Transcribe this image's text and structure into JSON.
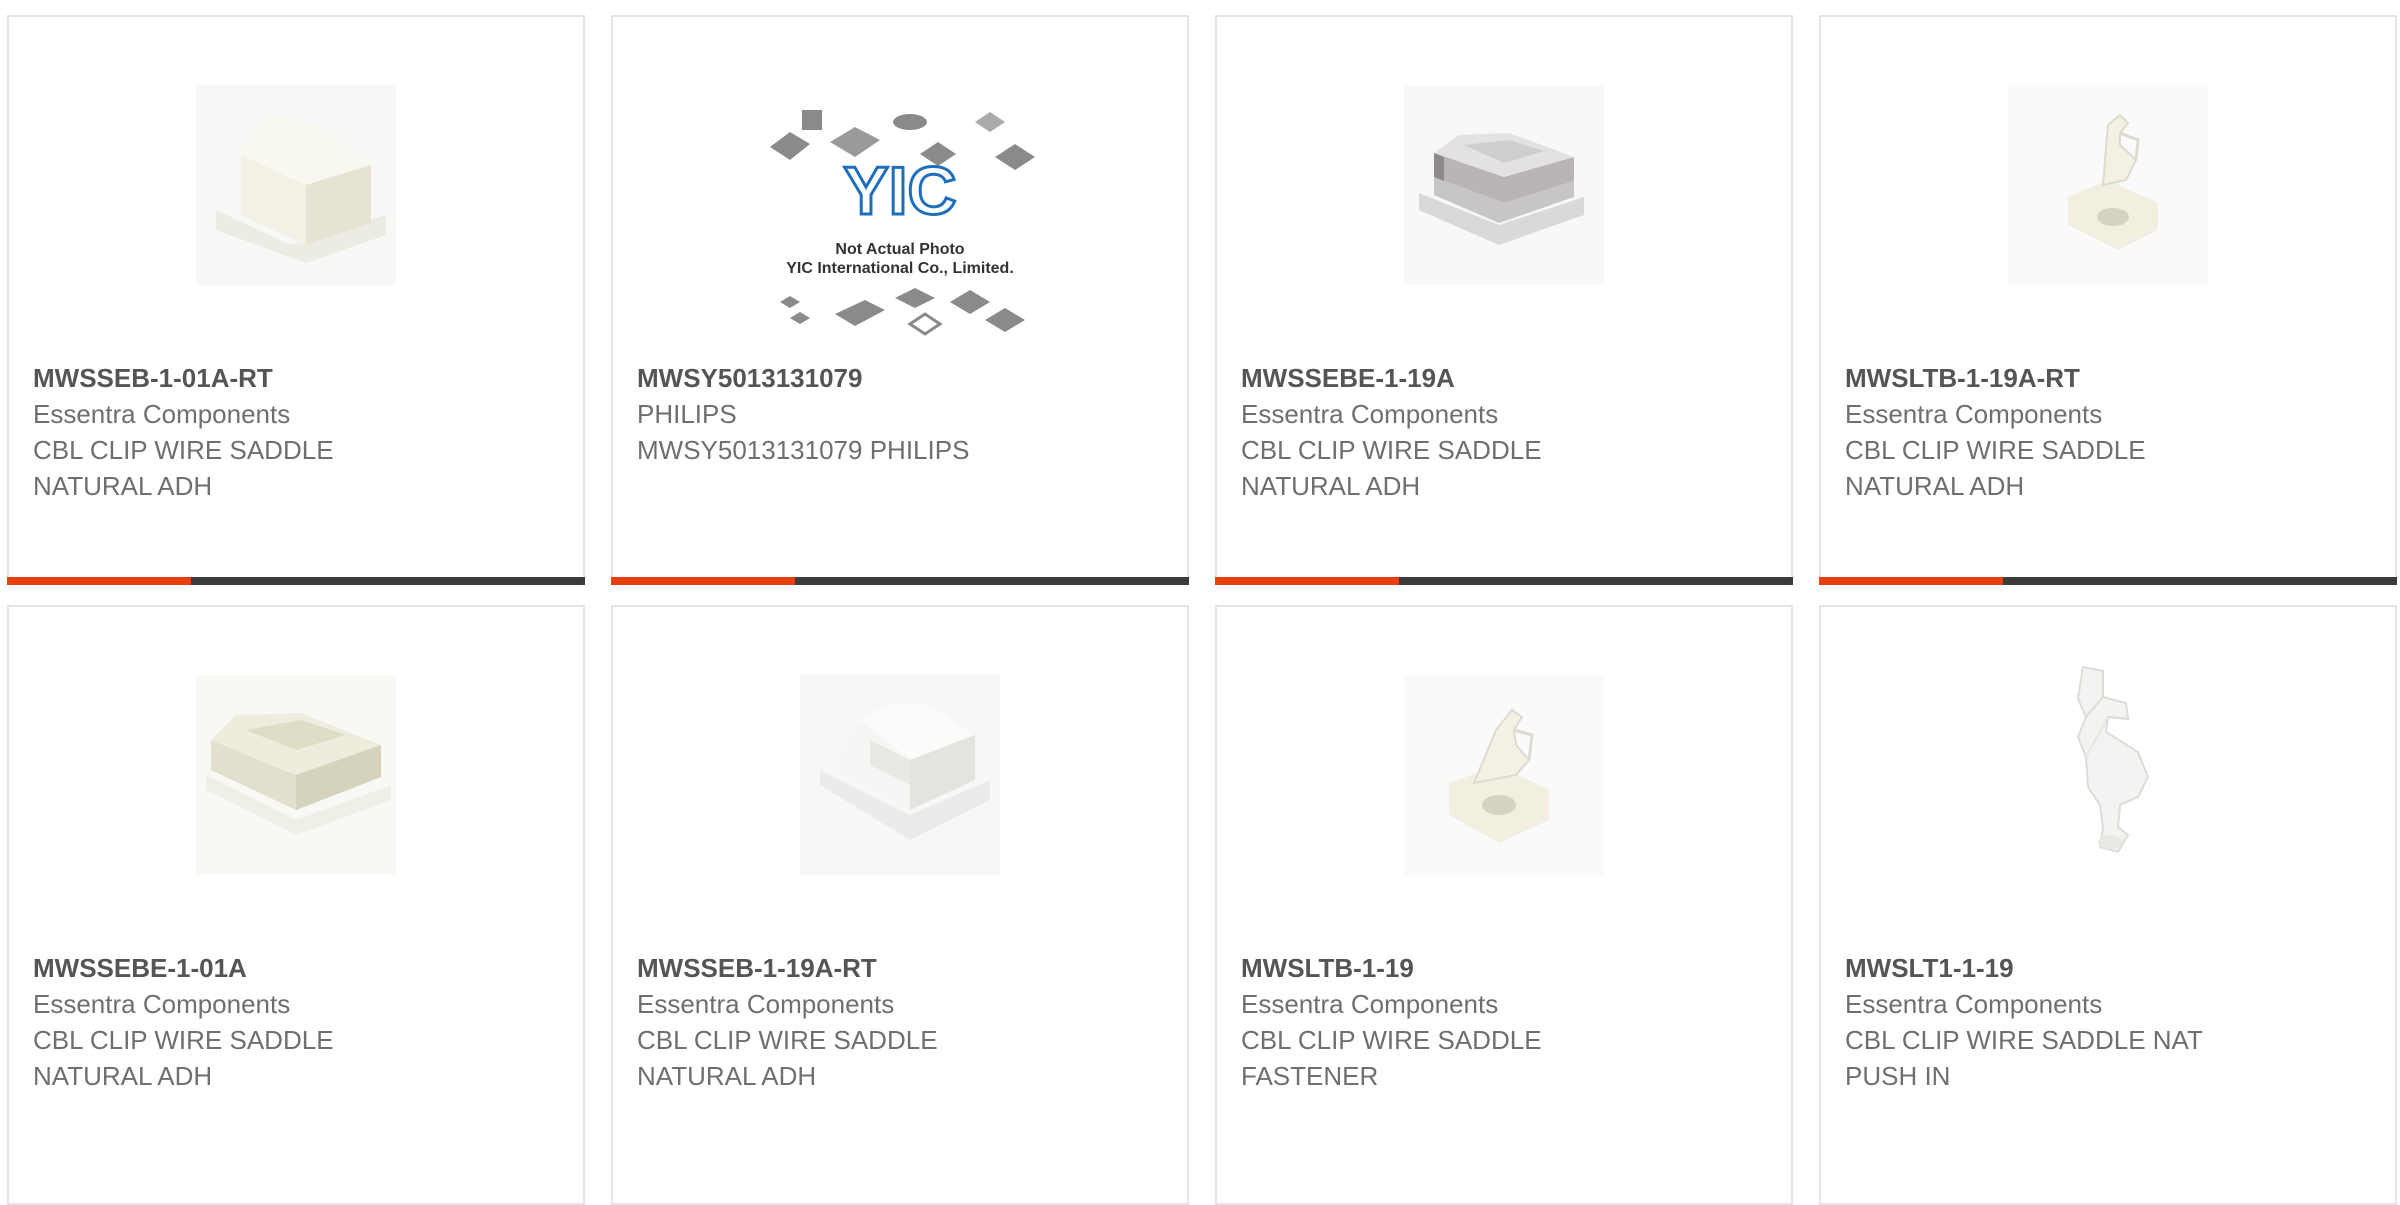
{
  "products": [
    {
      "part_number": "MWSSEB-1-01A-RT",
      "manufacturer": "Essentra Components",
      "description": "CBL CLIP WIRE SADDLE NATURAL ADH",
      "image_icon": "adhesive-saddle-clip-icon"
    },
    {
      "part_number": "MWSY5013131079",
      "manufacturer": "PHILIPS",
      "description": "MWSY5013131079 PHILIPS",
      "image_icon": "placeholder-chip-icon",
      "placeholder": {
        "logo_text": "YIC",
        "line1": "Not Actual Photo",
        "line2": "YIC International Co., Limited."
      }
    },
    {
      "part_number": "MWSSEBE-1-19A",
      "manufacturer": "Essentra Components",
      "description": "CBL CLIP WIRE SADDLE NATURAL ADH",
      "image_icon": "gray-saddle-clip-icon"
    },
    {
      "part_number": "MWSLTB-1-19A-RT",
      "manufacturer": "Essentra Components",
      "description": "CBL CLIP WIRE SADDLE NATURAL ADH",
      "image_icon": "latch-clip-icon"
    },
    {
      "part_number": "MWSSEBE-1-01A",
      "manufacturer": "Essentra Components",
      "description": "CBL CLIP WIRE SADDLE NATURAL ADH",
      "image_icon": "adhesive-saddle-clip-icon"
    },
    {
      "part_number": "MWSSEB-1-19A-RT",
      "manufacturer": "Essentra Components",
      "description": "CBL CLIP WIRE SADDLE NATURAL ADH",
      "image_icon": "adhesive-saddle-clip-icon"
    },
    {
      "part_number": "MWSLTB-1-19",
      "manufacturer": "Essentra Components",
      "description": "CBL CLIP WIRE SADDLE FASTENER",
      "image_icon": "latch-clip-icon"
    },
    {
      "part_number": "MWSLT1-1-19",
      "manufacturer": "Essentra Components",
      "description": "CBL CLIP WIRE SADDLE NAT PUSH IN",
      "image_icon": "push-in-clip-icon"
    }
  ],
  "colors": {
    "accent": "#e8400c",
    "bar": "#3b3b3b",
    "border": "#e4e4e4"
  }
}
